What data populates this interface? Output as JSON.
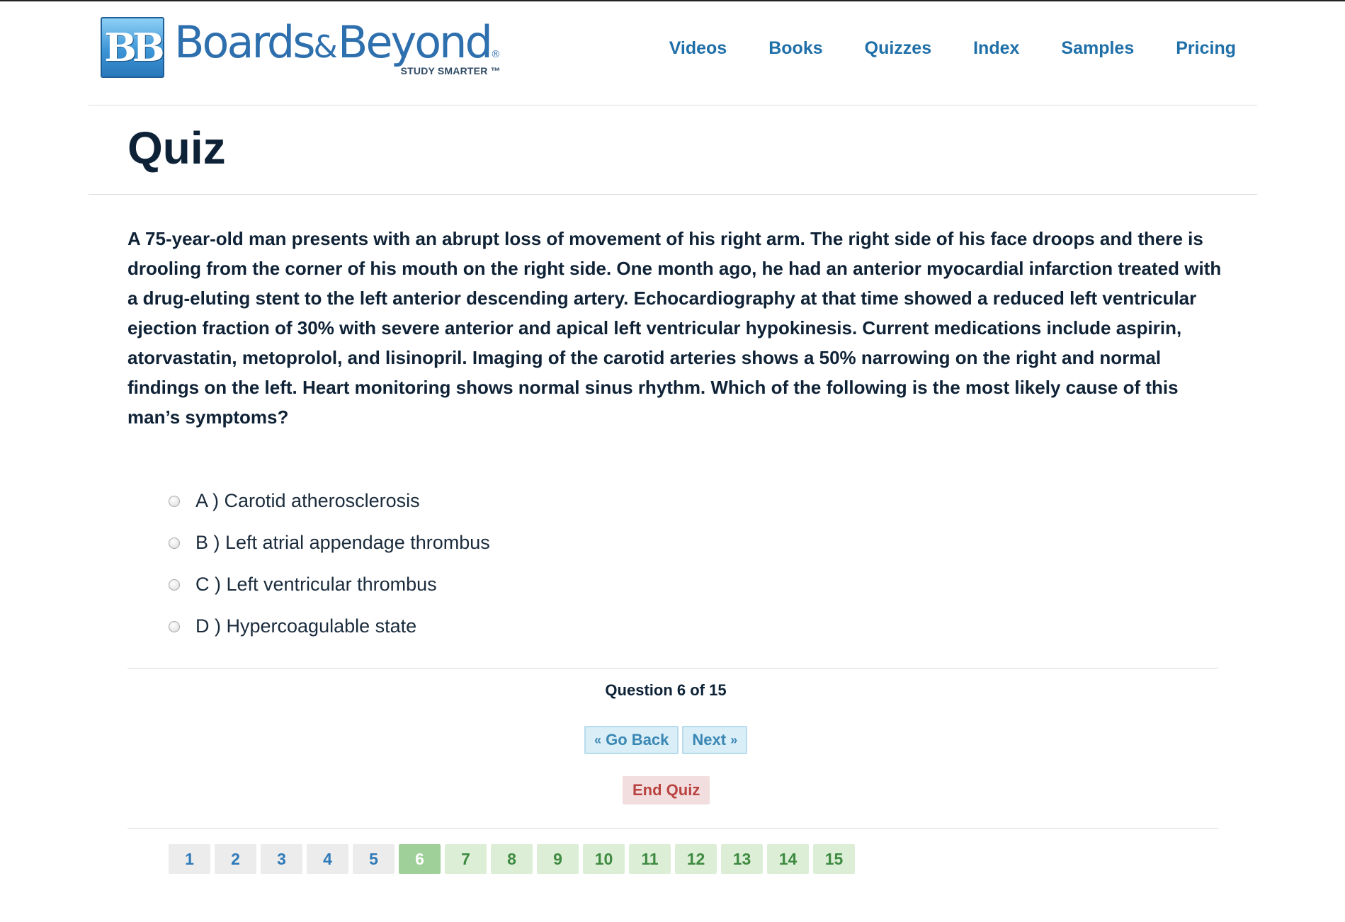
{
  "brand": {
    "logo_mark": "BB",
    "word_1": "Boards",
    "amp": "&",
    "word_2": "Beyond",
    "registered": "®",
    "tagline": "STUDY SMARTER ™"
  },
  "nav": [
    "Videos",
    "Books",
    "Quizzes",
    "Index",
    "Samples",
    "Pricing"
  ],
  "page_title": "Quiz",
  "question_text": "A 75-year-old man presents with an abrupt loss of movement of his right arm. The right side of his face droops and there is drooling from the corner of his mouth on the right side. One month ago, he had an anterior myocardial infarction treated with a drug-eluting stent to the left anterior descending artery. Echocardiography at that time showed a reduced left ventricular ejection fraction of 30% with severe anterior and apical left ventricular hypokinesis. Current medications include aspirin, atorvastatin, metoprolol, and lisinopril. Imaging of the carotid arteries shows a 50% narrowing on the right and normal findings on the left. Heart monitoring shows normal sinus rhythm. Which of the following is the most likely cause of this man’s symptoms?",
  "answers": [
    {
      "label": "A ) Carotid atherosclerosis",
      "selected": false
    },
    {
      "label": "B ) Left atrial appendage thrombus",
      "selected": false
    },
    {
      "label": "C ) Left ventricular thrombus",
      "selected": false
    },
    {
      "label": "D ) Hypercoagulable state",
      "selected": false
    }
  ],
  "progress_text": "Question 6 of 15",
  "buttons": {
    "back_chev": "«",
    "back_label": "Go Back",
    "next_label": "Next",
    "next_chev": "»",
    "end_label": "End Quiz"
  },
  "pager": {
    "pages": [
      "1",
      "2",
      "3",
      "4",
      "5",
      "6",
      "7",
      "8",
      "9",
      "10",
      "11",
      "12",
      "13",
      "14",
      "15"
    ],
    "current": 6
  },
  "colors": {
    "link": "#1f6fa8",
    "current_page": "#9fd09a",
    "upcoming_page": "#dcefd6",
    "end_button": "#f2dede"
  }
}
